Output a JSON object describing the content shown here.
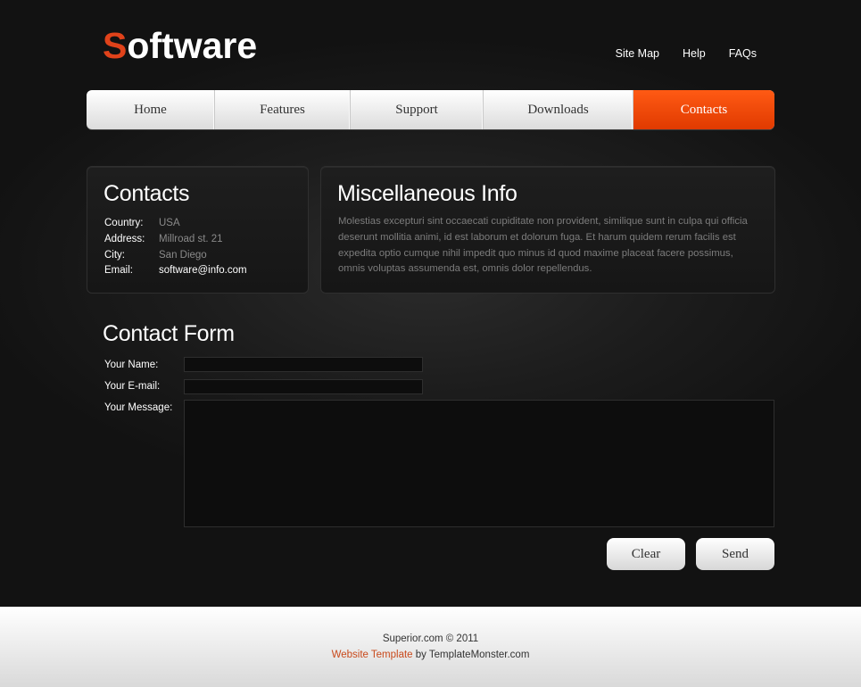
{
  "header": {
    "logo_first_letter": "S",
    "logo_rest": "oftware",
    "top_links": [
      "Site Map",
      "Help",
      "FAQs"
    ]
  },
  "nav": {
    "tabs": [
      {
        "label": "Home"
      },
      {
        "label": "Features"
      },
      {
        "label": "Support"
      },
      {
        "label": "Downloads"
      },
      {
        "label": "Contacts"
      }
    ],
    "active": "Contacts"
  },
  "contacts": {
    "title": "Contacts",
    "rows": [
      {
        "key": "Country:",
        "value": "USA"
      },
      {
        "key": "Address:",
        "value": "Millroad st. 21"
      },
      {
        "key": "City:",
        "value": "San Diego"
      },
      {
        "key": "Email:",
        "value": "software@info.com"
      }
    ]
  },
  "misc": {
    "title": "Miscellaneous Info",
    "text": "Molestias excepturi sint occaecati cupiditate non provident, similique sunt in culpa qui officia deserunt mollitia animi, id est laborum et dolorum fuga. Et harum quidem rerum facilis est expedita optio cumque nihil impedit quo minus id quod maxime placeat facere possimus, omnis voluptas assumenda est, omnis dolor repellendus."
  },
  "form": {
    "title": "Contact Form",
    "name_label": "Your Name:",
    "email_label": "Your E-mail:",
    "message_label": "Your Message:",
    "name_value": "",
    "email_value": "",
    "message_value": "",
    "clear_label": "Clear",
    "send_label": "Send"
  },
  "footer": {
    "line1": "Superior.com © 2011",
    "link_text": "Website Template",
    "by_text": " by TemplateMonster.com"
  },
  "colors": {
    "accent": "#e0421a",
    "active_tab": "#ff5a14",
    "background": "#141414",
    "footer_link": "#c94a1c"
  }
}
